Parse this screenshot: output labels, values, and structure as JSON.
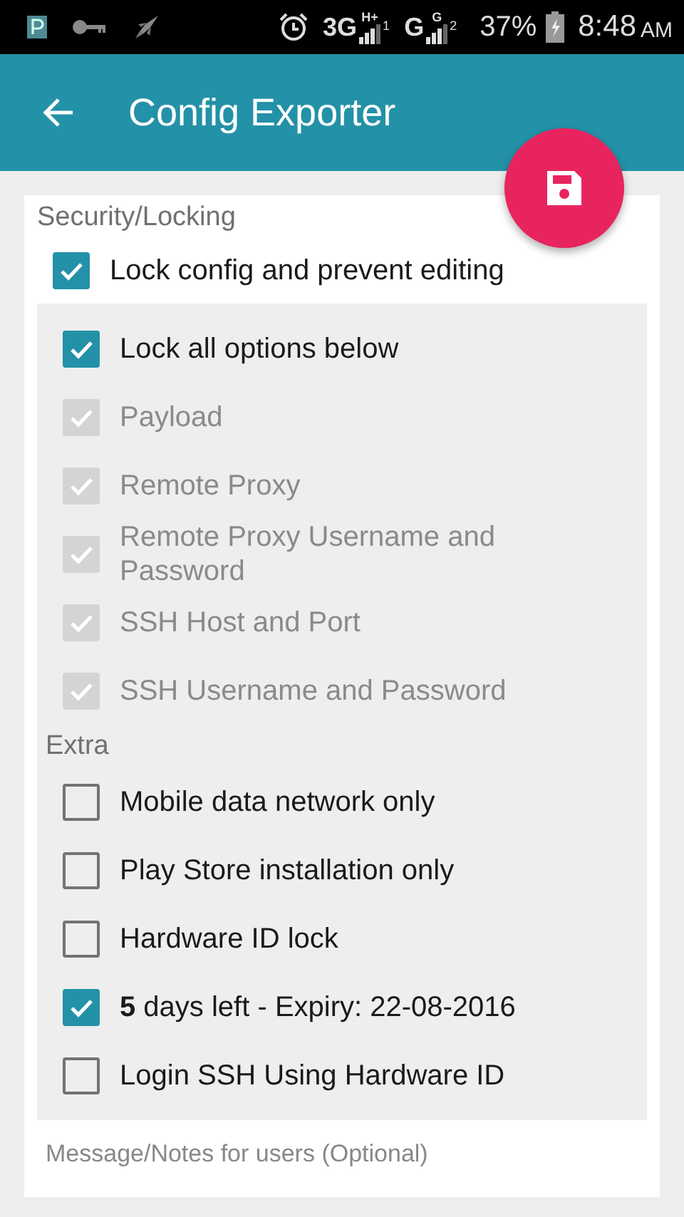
{
  "status_bar": {
    "networks": [
      {
        "type": "3G",
        "badge": "H+",
        "sim": "1"
      },
      {
        "type": "G",
        "badge": "G",
        "sim": "2"
      }
    ],
    "battery": "37%",
    "time": "8:48",
    "ampm": "AM"
  },
  "app_bar": {
    "title": "Config Exporter"
  },
  "security": {
    "title": "Security/Locking",
    "lock": {
      "label": "Lock config and prevent editing",
      "checked": true,
      "disabled": false
    }
  },
  "panel": {
    "items": [
      {
        "kind": "checkbox",
        "label": "Lock all options below",
        "checked": true,
        "disabled": false
      },
      {
        "kind": "checkbox",
        "label": "Payload",
        "checked": true,
        "disabled": true
      },
      {
        "kind": "checkbox",
        "label": "Remote Proxy",
        "checked": true,
        "disabled": true
      },
      {
        "kind": "checkbox",
        "label": "Remote Proxy Username and Password",
        "checked": true,
        "disabled": true
      },
      {
        "kind": "checkbox",
        "label": "SSH Host and Port",
        "checked": true,
        "disabled": true
      },
      {
        "kind": "checkbox",
        "label": "SSH Username and Password",
        "checked": true,
        "disabled": true
      },
      {
        "kind": "header",
        "label": "Extra"
      },
      {
        "kind": "checkbox",
        "label": "Mobile data network only",
        "checked": false,
        "disabled": false
      },
      {
        "kind": "checkbox",
        "label": "Play Store installation only",
        "checked": false,
        "disabled": false
      },
      {
        "kind": "checkbox",
        "label": "Hardware ID lock",
        "checked": false,
        "disabled": false
      },
      {
        "kind": "checkbox",
        "label": "**5** days left - Expiry: 22-08-2016",
        "checked": true,
        "disabled": false
      },
      {
        "kind": "checkbox",
        "label": "Login SSH Using Hardware ID",
        "checked": false,
        "disabled": false
      }
    ]
  },
  "notes": {
    "placeholder": "Message/Notes for users (Optional)"
  }
}
